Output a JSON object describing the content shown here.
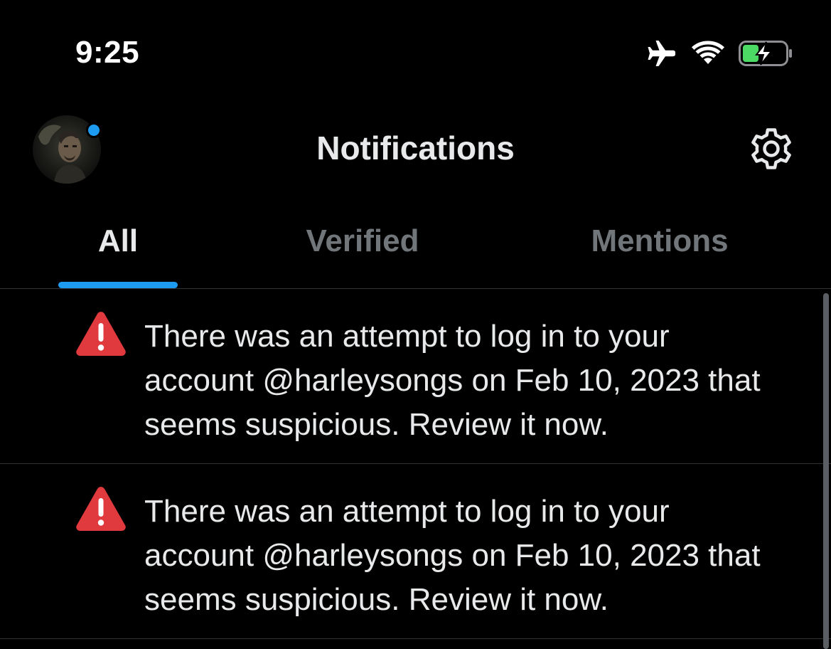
{
  "status_bar": {
    "time": "9:25",
    "icons": [
      "airplane-mode-icon",
      "wifi-icon",
      "battery-charging-icon"
    ]
  },
  "header": {
    "title": "Notifications",
    "avatar_has_new": true,
    "settings_icon": "gear-icon"
  },
  "tabs": [
    {
      "label": "All",
      "active": true
    },
    {
      "label": "Verified",
      "active": false
    },
    {
      "label": "Mentions",
      "active": false
    }
  ],
  "notifications": [
    {
      "icon": "warning-icon",
      "text": "There was an attempt to log in to your account @harleysongs on Feb 10, 2023 that seems suspicious. Review it now."
    },
    {
      "icon": "warning-icon",
      "text": "There was an attempt to log in to your account @harleysongs on Feb 10, 2023 that seems suspicious. Review it now."
    }
  ],
  "colors": {
    "background": "#000000",
    "accent": "#1d9bf0",
    "text_primary": "#e7e9ea",
    "text_secondary": "#71767b",
    "warning": "#e0393e",
    "divider": "#2f3336",
    "battery_fill": "#4cd964"
  }
}
